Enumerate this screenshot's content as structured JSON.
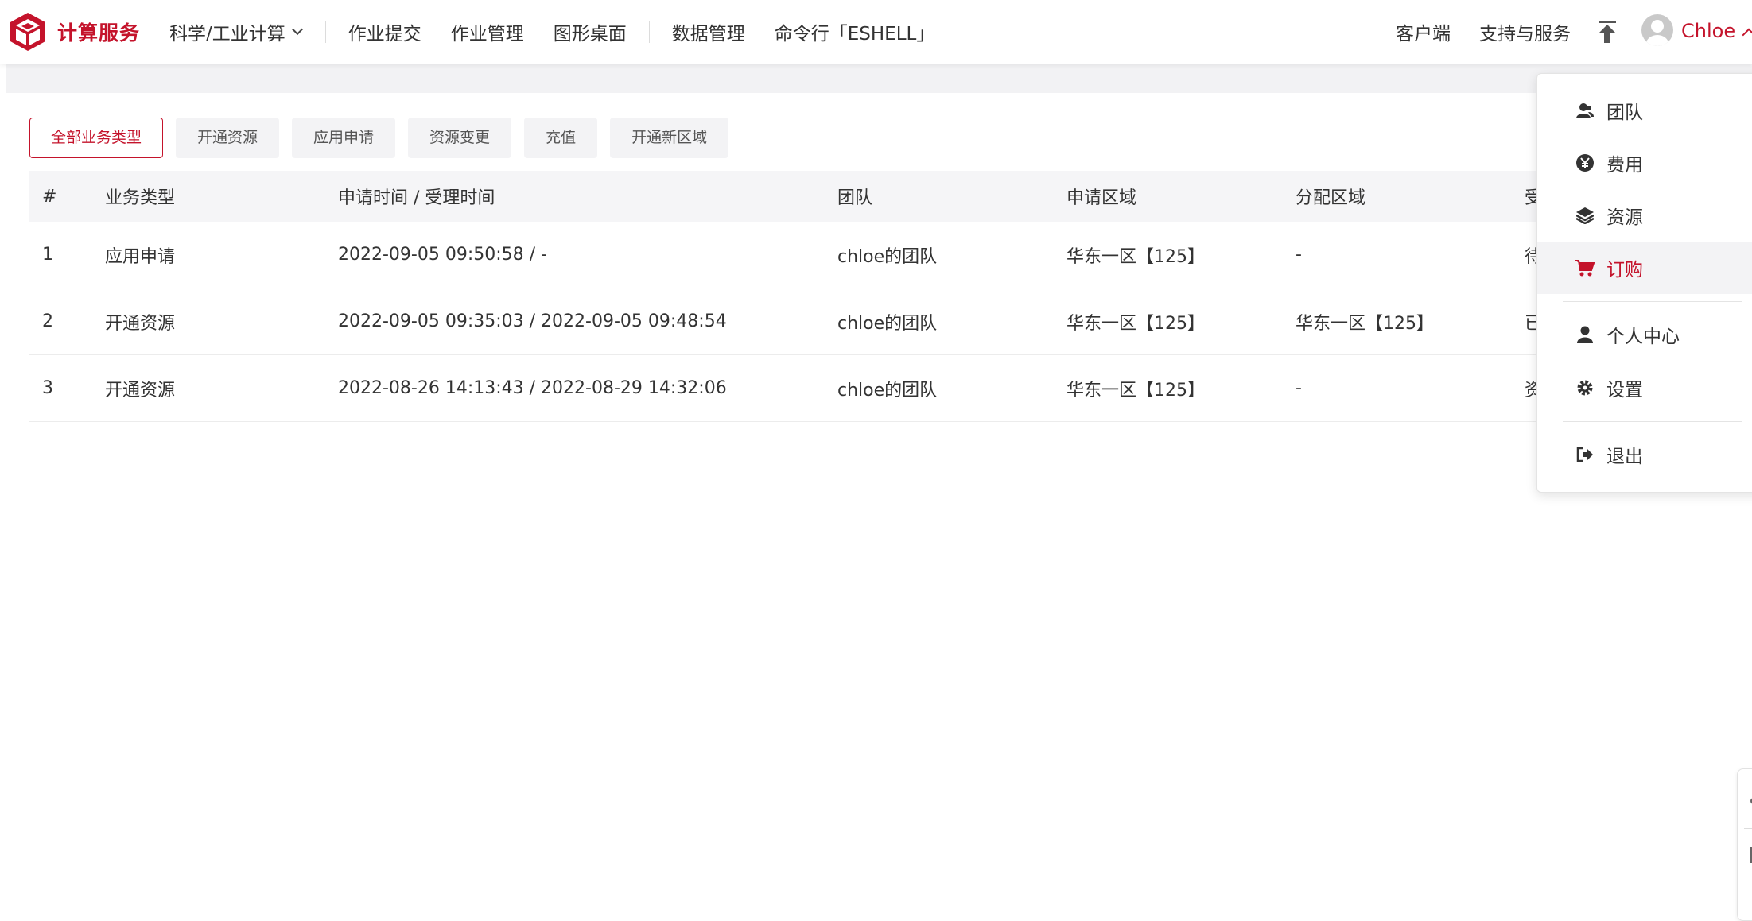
{
  "brand": {
    "name": "计算服务",
    "accent_color": "#c4132b"
  },
  "nav": {
    "items": [
      {
        "label": "科学/工业计算",
        "has_dropdown": true
      },
      {
        "label": "作业提交"
      },
      {
        "label": "作业管理"
      },
      {
        "label": "图形桌面"
      },
      {
        "label": "数据管理"
      },
      {
        "label": "命令行「ESHELL」"
      }
    ],
    "right": {
      "client": "客户端",
      "support": "支持与服务"
    },
    "upload_icon": "upload-icon"
  },
  "user": {
    "name": "Chloe",
    "avatar_icon": "user-avatar-icon"
  },
  "filters": {
    "items": [
      "全部业务类型",
      "开通资源",
      "应用申请",
      "资源变更",
      "充值",
      "开通新区域"
    ],
    "active_index": 0
  },
  "table": {
    "headers": [
      "#",
      "业务类型",
      "申请时间 / 受理时间",
      "团队",
      "申请区域",
      "分配区域",
      "受"
    ],
    "rows": [
      [
        "1",
        "应用申请",
        "2022-09-05 09:50:58 / -",
        "chloe的团队",
        "华东一区【125】",
        "-",
        "待"
      ],
      [
        "2",
        "开通资源",
        "2022-09-05 09:35:03 / 2022-09-05 09:48:54",
        "chloe的团队",
        "华东一区【125】",
        "华东一区【125】",
        "已"
      ],
      [
        "3",
        "开通资源",
        "2022-08-26 14:13:43 / 2022-08-29 14:32:06",
        "chloe的团队",
        "华东一区【125】",
        "-",
        "资"
      ]
    ]
  },
  "user_menu": {
    "items": [
      {
        "label": "团队",
        "icon": "team-icon"
      },
      {
        "label": "费用",
        "icon": "yen-coin-icon"
      },
      {
        "label": "资源",
        "icon": "layers-icon"
      },
      {
        "label": "订购",
        "icon": "cart-icon",
        "active": true
      },
      {
        "label": "个人中心",
        "icon": "person-icon"
      },
      {
        "label": "设置",
        "icon": "gear-icon"
      },
      {
        "label": "退出",
        "icon": "logout-icon"
      }
    ]
  }
}
